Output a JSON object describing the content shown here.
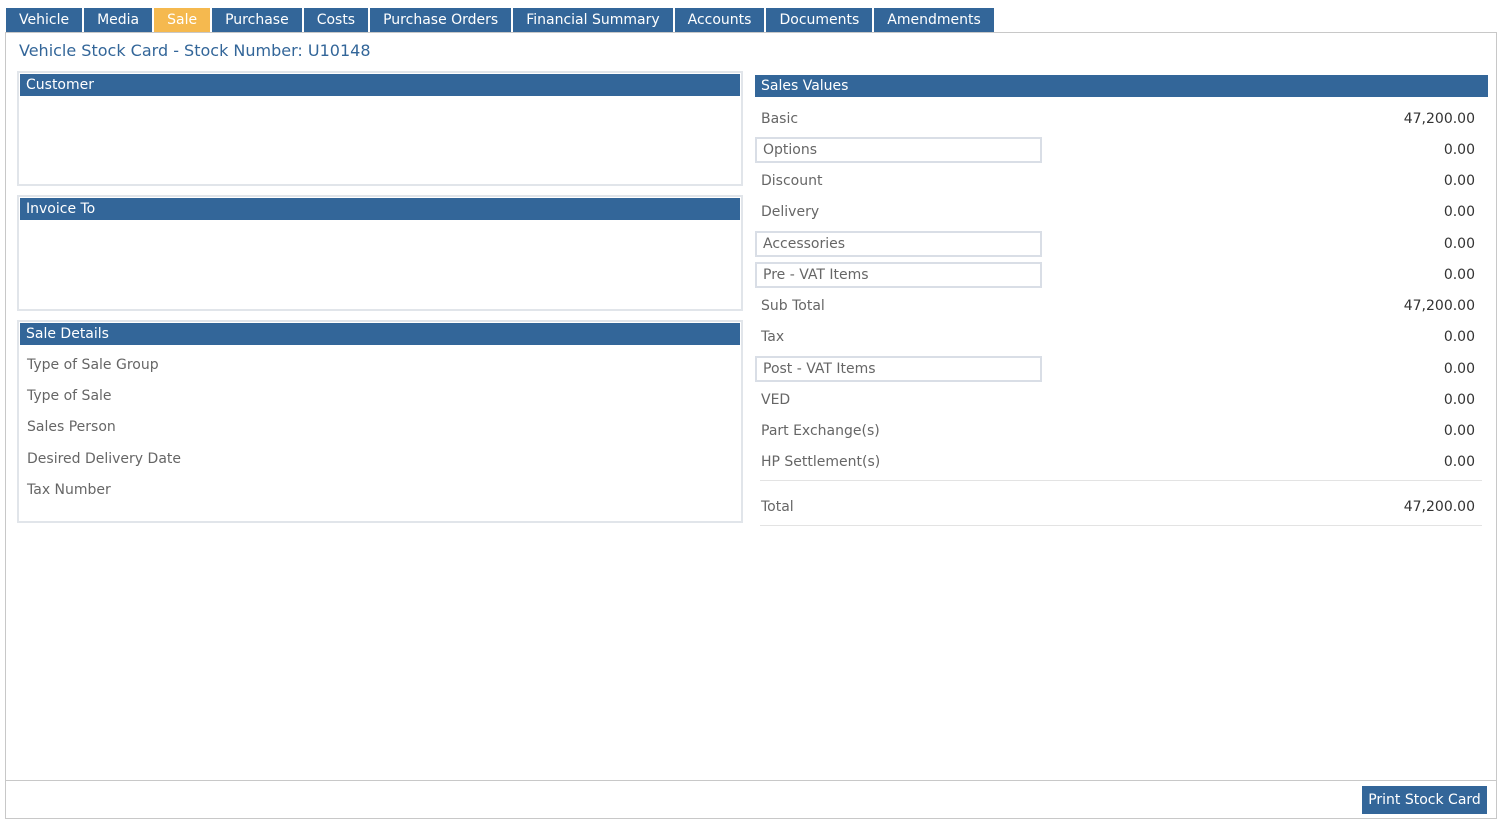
{
  "tabs": [
    {
      "label": "Vehicle",
      "active": false
    },
    {
      "label": "Media",
      "active": false
    },
    {
      "label": "Sale",
      "active": true
    },
    {
      "label": "Purchase",
      "active": false
    },
    {
      "label": "Costs",
      "active": false
    },
    {
      "label": "Purchase Orders",
      "active": false
    },
    {
      "label": "Financial Summary",
      "active": false
    },
    {
      "label": "Accounts",
      "active": false
    },
    {
      "label": "Documents",
      "active": false
    },
    {
      "label": "Amendments",
      "active": false
    }
  ],
  "page_title": "Vehicle Stock Card - Stock Number: U10148",
  "customer": {
    "title": "Customer"
  },
  "invoice_to": {
    "title": "Invoice To"
  },
  "sale_details": {
    "title": "Sale Details",
    "rows": [
      "Type of Sale Group",
      "Type of Sale",
      "Sales Person",
      "Desired Delivery Date",
      "Tax Number"
    ]
  },
  "sales_values": {
    "title": "Sales Values",
    "rows": [
      {
        "label": "Basic",
        "value": "47,200.00",
        "boxed": false
      },
      {
        "label": "Options",
        "value": "0.00",
        "boxed": true
      },
      {
        "label": "Discount",
        "value": "0.00",
        "boxed": false
      },
      {
        "label": "Delivery",
        "value": "0.00",
        "boxed": false
      },
      {
        "label": "Accessories",
        "value": "0.00",
        "boxed": true
      },
      {
        "label": "Pre - VAT Items",
        "value": "0.00",
        "boxed": true
      },
      {
        "label": "Sub Total",
        "value": "47,200.00",
        "boxed": false
      },
      {
        "label": "Tax",
        "value": "0.00",
        "boxed": false
      },
      {
        "label": "Post - VAT Items",
        "value": "0.00",
        "boxed": true
      },
      {
        "label": "VED",
        "value": "0.00",
        "boxed": false
      },
      {
        "label": "Part Exchange(s)",
        "value": "0.00",
        "boxed": false
      },
      {
        "label": "HP Settlement(s)",
        "value": "0.00",
        "boxed": false
      }
    ],
    "total_label": "Total",
    "total_value": "47,200.00"
  },
  "footer": {
    "print_button": "Print Stock Card"
  },
  "colors": {
    "primary": "#336699",
    "active_tab": "#f5b94f"
  }
}
